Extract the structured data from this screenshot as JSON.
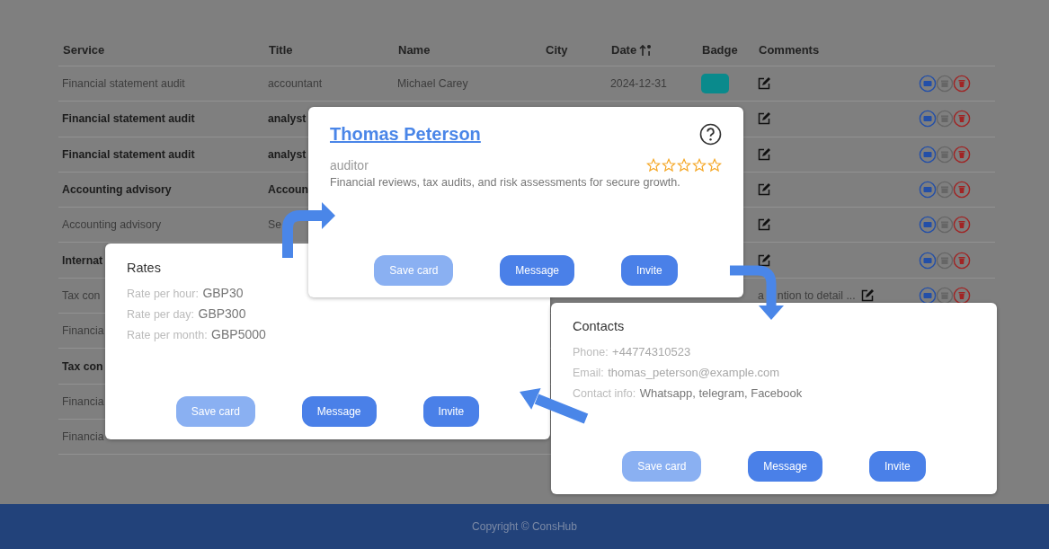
{
  "table": {
    "columns": [
      {
        "label": "Service",
        "sorted": false
      },
      {
        "label": "Title",
        "sorted": false
      },
      {
        "label": "Name",
        "sorted": false
      },
      {
        "label": "City",
        "sorted": false
      },
      {
        "label": "Date",
        "sorted": true
      },
      {
        "label": "Badge",
        "sorted": false
      },
      {
        "label": "Comments",
        "sorted": false
      }
    ],
    "rows": [
      {
        "bold": false,
        "service": "Financial statement audit",
        "title": "accountant",
        "name": "Michael Carey",
        "date": "2024-12-31",
        "color": "#0a8a8c",
        "comment_icon": true,
        "actions": true
      },
      {
        "bold": true,
        "service": "Financial statement audit",
        "title": "analyst",
        "comment_icon": true,
        "actions": true
      },
      {
        "bold": true,
        "service": "Financial statement audit",
        "title": "analyst",
        "comment_icon": true,
        "actions": true
      },
      {
        "bold": true,
        "service": "Accounting advisory",
        "title": "Accoun",
        "comment_icon": true,
        "actions": true
      },
      {
        "bold": false,
        "service": "Accounting advisory",
        "title": "Se",
        "comment_icon": true,
        "actions": true
      },
      {
        "bold": true,
        "service": "Internat",
        "comment_icon": true,
        "actions": true
      },
      {
        "bold": false,
        "service": "Tax con",
        "comment": [
          "a",
          "ntion to detail ..."
        ],
        "comment_icon": true,
        "actions": true
      },
      {
        "bold": false,
        "service": "Financia"
      },
      {
        "bold": true,
        "service": "Tax con"
      },
      {
        "bold": false,
        "service": "Financia"
      },
      {
        "bold": false,
        "service": "Financia"
      }
    ]
  },
  "cards": [
    {
      "kind": "profile",
      "name": "Thomas Peterson",
      "subtitle": "auditor",
      "stars": 0,
      "description": "Financial reviews, tax audits, and risk assessments for secure growth.",
      "buttons": [
        {
          "label": "Save card",
          "disabled": true
        },
        {
          "label": "Message",
          "disabled": false
        },
        {
          "label": "Invite",
          "disabled": false
        }
      ]
    },
    {
      "kind": "rates",
      "title": "Rates",
      "lines": [
        {
          "label": "Rate per hour:",
          "value": "GBP30"
        },
        {
          "label": "Rate per day:",
          "value": "GBP300"
        },
        {
          "label": "Rate per month:",
          "value": "GBP5000"
        }
      ],
      "buttons": [
        {
          "label": "Save card",
          "disabled": true
        },
        {
          "label": "Message",
          "disabled": false
        },
        {
          "label": "Invite",
          "disabled": false
        }
      ]
    },
    {
      "kind": "contacts",
      "title": "Contacts",
      "lines": [
        {
          "label": "Phone:",
          "value": "+44774310523"
        },
        {
          "label": "Email:",
          "value": "thomas_peterson@example.com"
        },
        {
          "label": "Contact info:",
          "value": "Whatsapp, telegram, Facebook"
        }
      ],
      "buttons": [
        {
          "label": "Save card",
          "disabled": true
        },
        {
          "label": "Message",
          "disabled": false
        },
        {
          "label": "Invite",
          "disabled": false
        }
      ]
    }
  ],
  "footer": {
    "text": "Copyright © ConsHub"
  }
}
